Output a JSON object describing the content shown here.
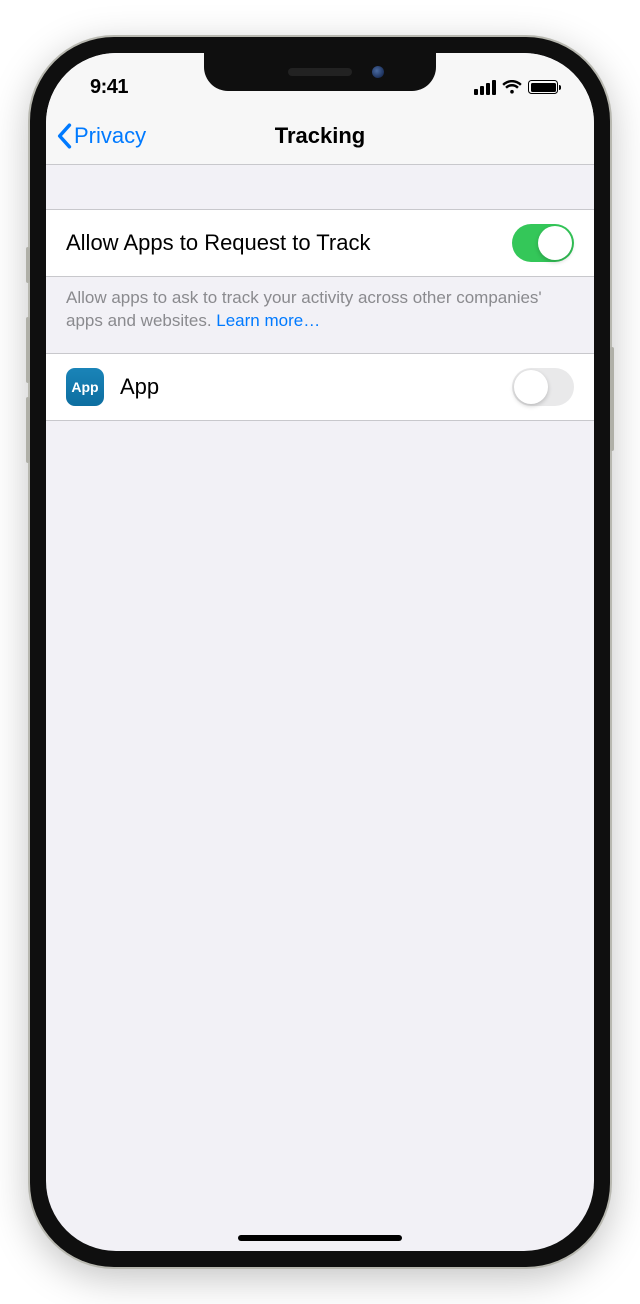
{
  "status_bar": {
    "time": "9:41"
  },
  "nav": {
    "back_label": "Privacy",
    "title": "Tracking"
  },
  "settings": {
    "allow_row": {
      "label": "Allow Apps to Request to Track",
      "enabled": true
    },
    "footer": {
      "text": "Allow apps to ask to track your activity across other companies' apps and websites. ",
      "link_label": "Learn more…"
    },
    "apps": [
      {
        "name": "App",
        "icon_text": "App",
        "enabled": false
      }
    ]
  }
}
